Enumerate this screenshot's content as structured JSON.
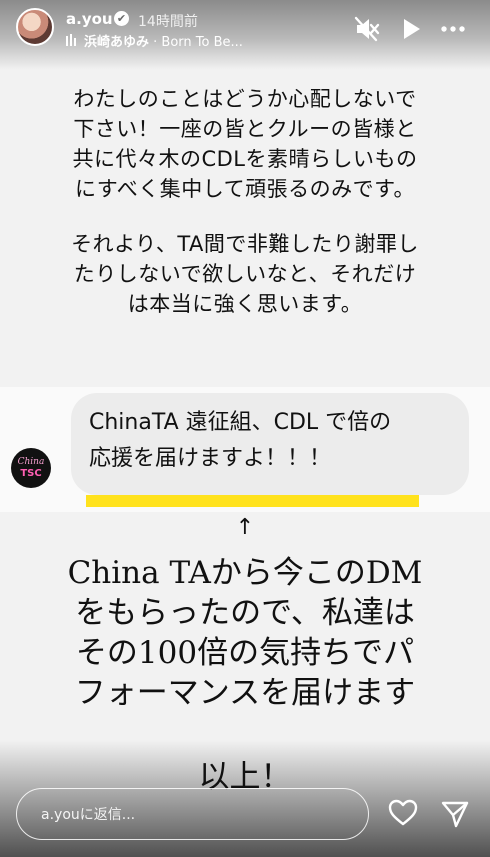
{
  "header": {
    "username": "a.you",
    "verified_glyph": "✔",
    "time": "14時間前",
    "song_artist": "浜崎あゆみ",
    "song_separator": " · ",
    "song_title": "Born To Be...",
    "icons": [
      "music-bars-icon",
      "mute-icon",
      "play-icon",
      "more-icon"
    ]
  },
  "story": {
    "paragraph1": [
      "わたしのことはどうか心配しないで",
      "下さい！一座の皆とクルーの皆様と",
      "共に代々木のCDLを素晴らしいもの",
      "にすべく集中して頑張るのみです。"
    ],
    "paragraph2": [
      "それより、TA間で非難したり謝罪し",
      "たりしないで欲しいなと、それだけ",
      "は本当に強く思います。"
    ],
    "dm": {
      "avatar_text": "China",
      "avatar_mark": "TSC",
      "message_lines": [
        "ChinaTA 遠征組、CDL で倍の",
        "応援を届けますよ！！！"
      ]
    },
    "arrow": "↑",
    "big_text": [
      "China TAから今このDM",
      "をもらったので、私達は",
      "その100倍の気持ちでパ",
      "フォーマンスを届けます"
    ],
    "closing": "以上！"
  },
  "footer": {
    "reply_placeholder": "a.youに返信...",
    "icons": [
      "heart-icon",
      "send-icon"
    ]
  },
  "colors": {
    "highlight": "#ffe21d",
    "bubble": "#ececec",
    "background": "#f2f2f2"
  }
}
